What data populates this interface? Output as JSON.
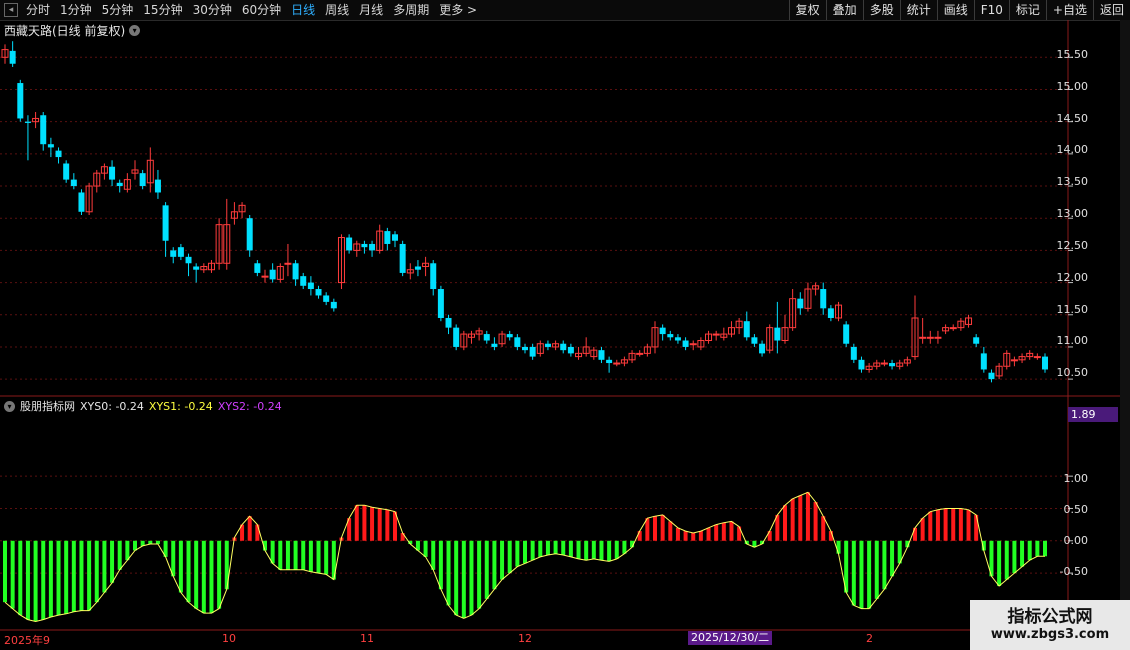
{
  "toolbar": {
    "periods": [
      "分时",
      "1分钟",
      "5分钟",
      "15分钟",
      "30分钟",
      "60分钟",
      "日线",
      "周线",
      "月线",
      "多周期",
      "更多 >"
    ],
    "active_period": "日线",
    "buttons": [
      "复权",
      "叠加",
      "多股",
      "统计",
      "画线",
      "F10",
      "标记",
      "+自选",
      "返回"
    ]
  },
  "main_chart": {
    "title": "西藏天路(日线 前复权)",
    "price_ticks": [
      "15.50",
      "15.00",
      "14.50",
      "14.00",
      "13.50",
      "13.00",
      "12.50",
      "12.00",
      "11.50",
      "11.00",
      "10.50"
    ]
  },
  "indicator": {
    "name": "股朋指标网",
    "xys0": "XYS0: -0.24",
    "xys1": "XYS1: -0.24",
    "xys2": "XYS2: -0.24",
    "current_value": "1.89",
    "ticks": [
      "1.00",
      "0.50",
      "0.00",
      "-0.50"
    ]
  },
  "date_axis": {
    "labels": [
      "2025年9",
      "10",
      "11",
      "12",
      "2"
    ],
    "highlight": "2025/12/30/二"
  },
  "colors": {
    "up": "#ff3c3c",
    "down": "#00e0ff",
    "pos": "#ff1a1a",
    "neg": "#22ff22",
    "accent": "#2fb0ff"
  },
  "watermark": {
    "title": "指标公式网",
    "url": "www.zbgs3.com"
  },
  "chart_data": {
    "type": "bar",
    "title": "西藏天路(日线 前复权)",
    "ylim": [
      10.3,
      15.8
    ],
    "indicator_ylim": [
      -1.35,
      1.9
    ],
    "candles": [
      [
        15.5,
        15.62,
        15.7,
        15.4
      ],
      [
        15.6,
        15.4,
        15.75,
        15.35
      ],
      [
        15.1,
        14.55,
        15.15,
        14.5
      ],
      [
        14.5,
        14.48,
        14.6,
        13.9
      ],
      [
        14.5,
        14.55,
        14.65,
        14.4
      ],
      [
        14.6,
        14.15,
        14.65,
        14.05
      ],
      [
        14.15,
        14.1,
        14.25,
        13.95
      ],
      [
        14.05,
        13.95,
        14.1,
        13.85
      ],
      [
        13.85,
        13.6,
        13.9,
        13.55
      ],
      [
        13.6,
        13.5,
        13.7,
        13.45
      ],
      [
        13.4,
        13.1,
        13.45,
        13.05
      ],
      [
        13.1,
        13.5,
        13.55,
        13.05
      ],
      [
        13.5,
        13.7,
        13.75,
        13.4
      ],
      [
        13.7,
        13.8,
        13.85,
        13.6
      ],
      [
        13.8,
        13.6,
        13.9,
        13.5
      ],
      [
        13.55,
        13.5,
        13.6,
        13.4
      ],
      [
        13.45,
        13.6,
        13.7,
        13.4
      ],
      [
        13.7,
        13.75,
        13.9,
        13.6
      ],
      [
        13.7,
        13.5,
        13.75,
        13.45
      ],
      [
        13.55,
        13.9,
        14.1,
        13.4
      ],
      [
        13.6,
        13.4,
        13.75,
        13.3
      ],
      [
        13.2,
        12.65,
        13.25,
        12.4
      ],
      [
        12.5,
        12.4,
        12.55,
        12.3
      ],
      [
        12.55,
        12.4,
        12.6,
        12.35
      ],
      [
        12.4,
        12.3,
        12.45,
        12.1
      ],
      [
        12.25,
        12.2,
        12.3,
        12.0
      ],
      [
        12.2,
        12.25,
        12.3,
        12.15
      ],
      [
        12.2,
        12.3,
        12.35,
        12.15
      ],
      [
        12.3,
        12.9,
        13.0,
        12.2
      ],
      [
        12.3,
        12.9,
        13.3,
        12.2
      ],
      [
        13.0,
        13.1,
        13.25,
        12.9
      ],
      [
        13.1,
        13.2,
        13.25,
        13.0
      ],
      [
        13.0,
        12.5,
        13.05,
        12.4
      ],
      [
        12.3,
        12.15,
        12.35,
        12.1
      ],
      [
        12.1,
        12.1,
        12.2,
        12.0
      ],
      [
        12.2,
        12.05,
        12.3,
        12.0
      ],
      [
        12.05,
        12.25,
        12.3,
        12.0
      ],
      [
        12.3,
        12.3,
        12.6,
        12.1
      ],
      [
        12.3,
        12.05,
        12.35,
        11.95
      ],
      [
        12.1,
        11.95,
        12.15,
        11.9
      ],
      [
        12.0,
        11.9,
        12.1,
        11.8
      ],
      [
        11.9,
        11.8,
        11.95,
        11.75
      ],
      [
        11.8,
        11.7,
        11.85,
        11.65
      ],
      [
        11.7,
        11.6,
        11.75,
        11.55
      ],
      [
        12.0,
        12.7,
        12.75,
        11.9
      ],
      [
        12.7,
        12.5,
        12.75,
        12.45
      ],
      [
        12.5,
        12.6,
        12.65,
        12.4
      ],
      [
        12.6,
        12.55,
        12.65,
        12.45
      ],
      [
        12.6,
        12.5,
        12.65,
        12.4
      ],
      [
        12.5,
        12.8,
        12.9,
        12.45
      ],
      [
        12.8,
        12.6,
        12.85,
        12.5
      ],
      [
        12.75,
        12.65,
        12.8,
        12.55
      ],
      [
        12.6,
        12.15,
        12.65,
        12.1
      ],
      [
        12.15,
        12.2,
        12.3,
        12.05
      ],
      [
        12.25,
        12.2,
        12.35,
        12.1
      ],
      [
        12.25,
        12.3,
        12.4,
        12.1
      ],
      [
        12.3,
        11.9,
        12.35,
        11.8
      ],
      [
        11.9,
        11.45,
        11.95,
        11.4
      ],
      [
        11.45,
        11.3,
        11.5,
        11.2
      ],
      [
        11.3,
        11.0,
        11.35,
        10.95
      ],
      [
        11.0,
        11.2,
        11.25,
        10.95
      ],
      [
        11.15,
        11.2,
        11.25,
        11.05
      ],
      [
        11.2,
        11.25,
        11.3,
        11.1
      ],
      [
        11.2,
        11.1,
        11.25,
        11.05
      ],
      [
        11.05,
        11.0,
        11.15,
        10.95
      ],
      [
        11.05,
        11.2,
        11.25,
        11.0
      ],
      [
        11.2,
        11.15,
        11.25,
        11.1
      ],
      [
        11.15,
        11.0,
        11.2,
        10.95
      ],
      [
        11.0,
        10.95,
        11.05,
        10.9
      ],
      [
        11.0,
        10.85,
        11.05,
        10.8
      ],
      [
        10.9,
        11.05,
        11.1,
        10.85
      ],
      [
        11.05,
        11.0,
        11.1,
        10.95
      ],
      [
        11.0,
        11.05,
        11.1,
        10.95
      ],
      [
        11.05,
        10.95,
        11.1,
        10.9
      ],
      [
        11.0,
        10.9,
        11.05,
        10.85
      ],
      [
        10.85,
        10.9,
        11.0,
        10.8
      ],
      [
        10.9,
        11.0,
        11.15,
        10.85
      ],
      [
        10.85,
        10.95,
        11.0,
        10.8
      ],
      [
        10.95,
        10.8,
        11.0,
        10.75
      ],
      [
        10.8,
        10.75,
        10.85,
        10.6
      ],
      [
        10.75,
        10.75,
        10.8,
        10.7
      ],
      [
        10.75,
        10.8,
        10.85,
        10.7
      ],
      [
        10.8,
        10.9,
        10.95,
        10.75
      ],
      [
        10.9,
        10.9,
        10.95,
        10.85
      ],
      [
        10.9,
        11.0,
        11.05,
        10.85
      ],
      [
        11.0,
        11.3,
        11.4,
        10.9
      ],
      [
        11.3,
        11.2,
        11.35,
        11.1
      ],
      [
        11.2,
        11.15,
        11.25,
        11.1
      ],
      [
        11.15,
        11.1,
        11.2,
        11.05
      ],
      [
        11.1,
        11.0,
        11.15,
        10.95
      ],
      [
        11.05,
        11.05,
        11.1,
        10.95
      ],
      [
        11.0,
        11.1,
        11.15,
        10.95
      ],
      [
        11.1,
        11.2,
        11.25,
        11.05
      ],
      [
        11.2,
        11.2,
        11.25,
        11.1
      ],
      [
        11.15,
        11.2,
        11.3,
        11.1
      ],
      [
        11.2,
        11.3,
        11.4,
        11.15
      ],
      [
        11.3,
        11.4,
        11.45,
        11.2
      ],
      [
        11.4,
        11.15,
        11.55,
        11.1
      ],
      [
        11.15,
        11.05,
        11.2,
        11.0
      ],
      [
        11.05,
        10.9,
        11.1,
        10.85
      ],
      [
        10.95,
        11.3,
        11.35,
        10.9
      ],
      [
        11.3,
        11.1,
        11.7,
        10.9
      ],
      [
        11.1,
        11.3,
        11.5,
        11.05
      ],
      [
        11.3,
        11.75,
        11.9,
        11.25
      ],
      [
        11.75,
        11.6,
        11.85,
        11.5
      ],
      [
        11.6,
        11.9,
        12.0,
        11.55
      ],
      [
        11.9,
        11.95,
        12.0,
        11.8
      ],
      [
        11.9,
        11.6,
        12.0,
        11.5
      ],
      [
        11.6,
        11.45,
        11.65,
        11.4
      ],
      [
        11.45,
        11.65,
        11.7,
        11.4
      ],
      [
        11.35,
        11.05,
        11.4,
        11.0
      ],
      [
        11.0,
        10.8,
        11.05,
        10.75
      ],
      [
        10.8,
        10.65,
        10.85,
        10.6
      ],
      [
        10.65,
        10.7,
        10.75,
        10.6
      ],
      [
        10.7,
        10.75,
        10.8,
        10.65
      ],
      [
        10.75,
        10.75,
        10.8,
        10.7
      ],
      [
        10.75,
        10.7,
        10.8,
        10.65
      ],
      [
        10.7,
        10.75,
        10.8,
        10.65
      ],
      [
        10.75,
        10.8,
        10.85,
        10.7
      ],
      [
        10.85,
        11.45,
        11.8,
        10.8
      ],
      [
        11.15,
        11.15,
        11.45,
        11.05
      ],
      [
        11.15,
        11.15,
        11.25,
        11.05
      ],
      [
        11.15,
        11.15,
        11.25,
        11.05
      ],
      [
        11.25,
        11.3,
        11.35,
        11.2
      ],
      [
        11.3,
        11.3,
        11.35,
        11.25
      ],
      [
        11.3,
        11.4,
        11.45,
        11.25
      ],
      [
        11.35,
        11.45,
        11.5,
        11.3
      ],
      [
        11.15,
        11.05,
        11.2,
        11.0
      ],
      [
        10.9,
        10.65,
        11.0,
        10.6
      ],
      [
        10.6,
        10.5,
        10.65,
        10.45
      ],
      [
        10.55,
        10.7,
        10.75,
        10.5
      ],
      [
        10.7,
        10.9,
        10.95,
        10.65
      ],
      [
        10.8,
        10.8,
        10.85,
        10.7
      ],
      [
        10.8,
        10.85,
        10.9,
        10.75
      ],
      [
        10.85,
        10.9,
        10.95,
        10.8
      ],
      [
        10.85,
        10.85,
        10.9,
        10.8
      ],
      [
        10.85,
        10.65,
        10.9,
        10.6
      ]
    ],
    "indicator_values": [
      -0.95,
      -1.05,
      -1.15,
      -1.22,
      -1.25,
      -1.22,
      -1.18,
      -1.15,
      -1.13,
      -1.1,
      -1.08,
      -1.08,
      -0.95,
      -0.8,
      -0.65,
      -0.45,
      -0.3,
      -0.15,
      -0.08,
      -0.05,
      -0.05,
      -0.25,
      -0.55,
      -0.8,
      -0.95,
      -1.05,
      -1.12,
      -1.12,
      -1.05,
      -0.75,
      0.05,
      0.25,
      0.38,
      0.25,
      -0.15,
      -0.35,
      -0.45,
      -0.45,
      -0.45,
      -0.45,
      -0.48,
      -0.5,
      -0.52,
      -0.6,
      0.05,
      0.35,
      0.55,
      0.55,
      0.52,
      0.5,
      0.48,
      0.45,
      0.12,
      -0.05,
      -0.15,
      -0.25,
      -0.45,
      -0.75,
      -1.0,
      -1.15,
      -1.2,
      -1.15,
      -1.05,
      -0.9,
      -0.75,
      -0.6,
      -0.5,
      -0.4,
      -0.35,
      -0.3,
      -0.25,
      -0.22,
      -0.2,
      -0.22,
      -0.25,
      -0.28,
      -0.3,
      -0.28,
      -0.3,
      -0.32,
      -0.28,
      -0.2,
      -0.1,
      0.15,
      0.35,
      0.38,
      0.4,
      0.3,
      0.2,
      0.15,
      0.12,
      0.15,
      0.2,
      0.25,
      0.28,
      0.3,
      0.22,
      -0.05,
      -0.1,
      -0.05,
      0.15,
      0.4,
      0.55,
      0.65,
      0.7,
      0.75,
      0.6,
      0.38,
      0.15,
      -0.2,
      -0.8,
      -1.0,
      -1.05,
      -1.05,
      -0.9,
      -0.75,
      -0.55,
      -0.35,
      -0.1,
      0.2,
      0.35,
      0.45,
      0.48,
      0.5,
      0.5,
      0.5,
      0.48,
      0.4,
      -0.15,
      -0.55,
      -0.7,
      -0.6,
      -0.5,
      -0.4,
      -0.3,
      -0.24,
      -0.24
    ]
  }
}
